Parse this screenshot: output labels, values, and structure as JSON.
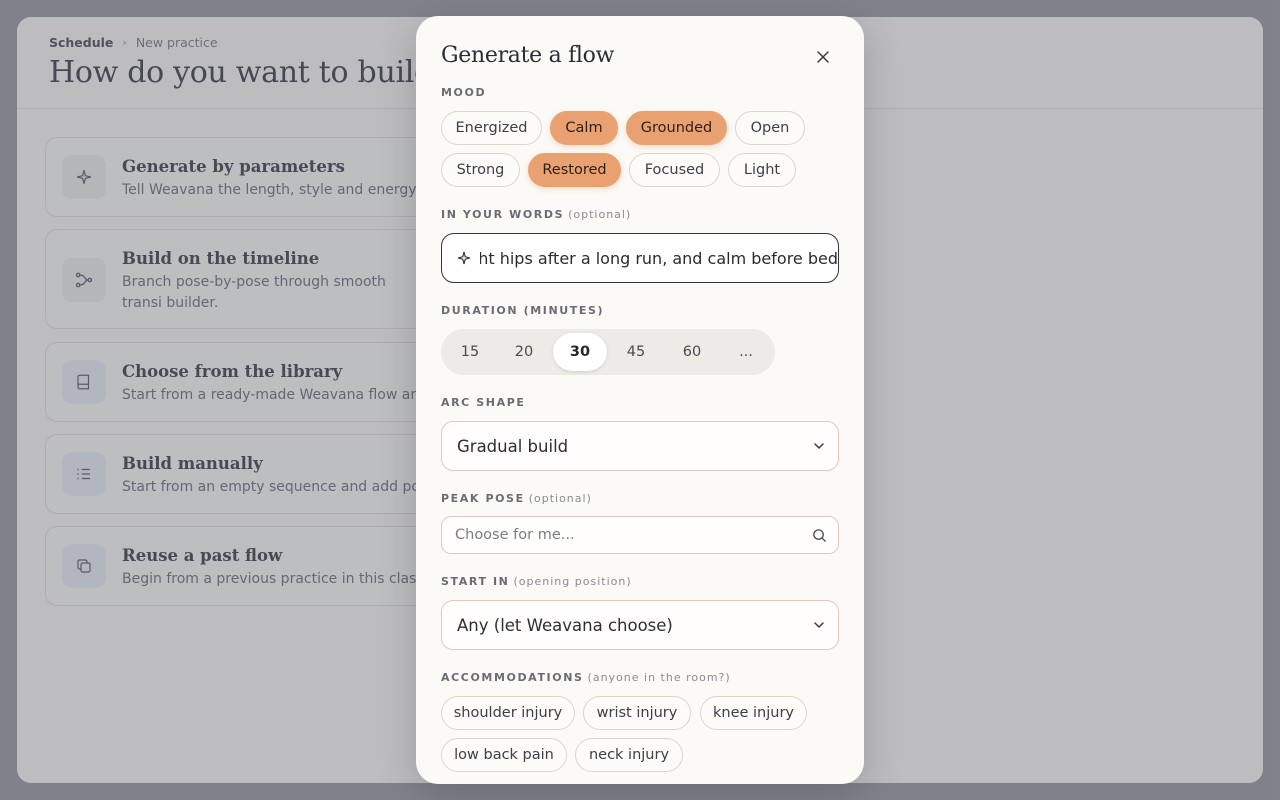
{
  "background": {
    "breadcrumb": {
      "first": "Schedule",
      "current": "New practice"
    },
    "title": "How do you want to build this",
    "options": [
      {
        "title": "Generate by parameters",
        "desc": "Tell Weavana the length, style and energy —"
      },
      {
        "title": "Build on the timeline",
        "desc": "Branch pose-by-pose through smooth transi builder."
      },
      {
        "title": "Choose from the library",
        "desc": "Start from a ready-made Weavana flow and a"
      },
      {
        "title": "Build manually",
        "desc": "Start from an empty sequence and add pose"
      },
      {
        "title": "Reuse a past flow",
        "desc": "Begin from a previous practice in this class a"
      }
    ]
  },
  "modal": {
    "title": "Generate a flow",
    "mood": {
      "label": "MOOD",
      "chips": [
        {
          "label": "Energized",
          "selected": false
        },
        {
          "label": "Calm",
          "selected": true
        },
        {
          "label": "Grounded",
          "selected": true
        },
        {
          "label": "Open",
          "selected": false
        },
        {
          "label": "Strong",
          "selected": false
        },
        {
          "label": "Restored",
          "selected": true
        },
        {
          "label": "Focused",
          "selected": false
        },
        {
          "label": "Light",
          "selected": false
        }
      ]
    },
    "words": {
      "label": "IN YOUR WORDS",
      "optional": "(optional)",
      "value": "ght hips after a long run, and calm before bed"
    },
    "duration": {
      "label": "DURATION (MINUTES)",
      "options": [
        "15",
        "20",
        "30",
        "45",
        "60",
        "..."
      ],
      "selected": "30"
    },
    "arc": {
      "label": "ARC SHAPE",
      "value": "Gradual build"
    },
    "peak": {
      "label": "PEAK POSE",
      "optional": "(optional)",
      "placeholder": "Choose for me..."
    },
    "start": {
      "label": "START IN",
      "optional": "(opening position)",
      "value": "Any (let Weavana choose)"
    },
    "accommodations": {
      "label": "ACCOMMODATIONS",
      "optional": "(anyone in the room?)",
      "chips": [
        "shoulder injury",
        "wrist injury",
        "knee injury",
        "low back pain",
        "neck injury"
      ]
    },
    "accent_color": "#e9a172"
  }
}
